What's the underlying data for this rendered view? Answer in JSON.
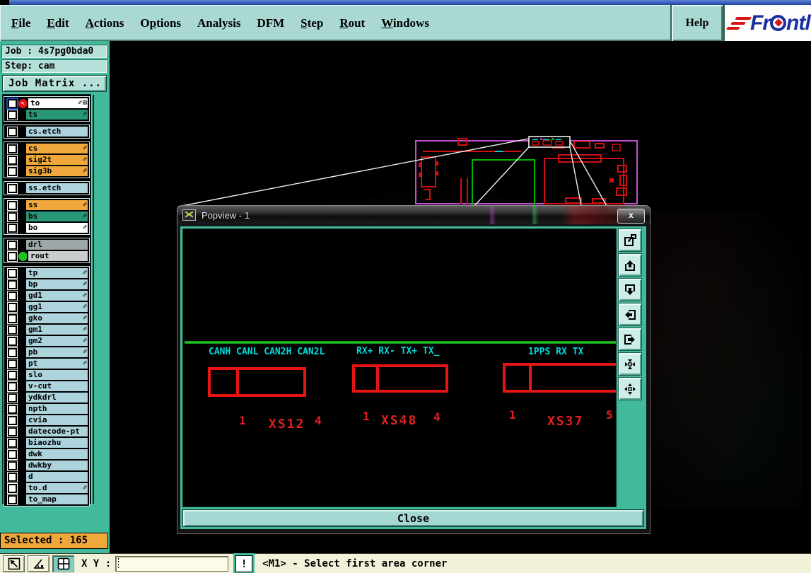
{
  "menu": {
    "items": [
      {
        "label": "File",
        "mnemonic": "F"
      },
      {
        "label": "Edit",
        "mnemonic": "E"
      },
      {
        "label": "Actions",
        "mnemonic": "A"
      },
      {
        "label": "Options",
        "mnemonic": "p"
      },
      {
        "label": "Analysis",
        "mnemonic": ""
      },
      {
        "label": "DFM",
        "mnemonic": ""
      },
      {
        "label": "Step",
        "mnemonic": "S"
      },
      {
        "label": "Rout",
        "mnemonic": "R"
      },
      {
        "label": "Windows",
        "mnemonic": "W"
      }
    ],
    "help_label": "Help",
    "logo": {
      "pre": "Fr",
      "post": "ntl"
    }
  },
  "sidebar": {
    "job_label": "Job : 4s7pg0bda0",
    "step_label": "Step: cam",
    "job_matrix_label": "Job Matrix ...",
    "selected_label": "Selected : 165",
    "layer_groups": [
      [
        {
          "name": "to",
          "color": "white",
          "pencil": true,
          "grid": true,
          "marker": "red",
          "focus": true
        },
        {
          "name": "ts",
          "color": "green",
          "pencil": true
        }
      ],
      [
        {
          "name": "cs.etch",
          "color": "blue"
        }
      ],
      [
        {
          "name": "cs",
          "color": "orange",
          "pencil": true
        },
        {
          "name": "sig2t",
          "color": "orange",
          "pencil": true
        },
        {
          "name": "sig3b",
          "color": "orange",
          "pencil": true
        }
      ],
      [
        {
          "name": "ss.etch",
          "color": "blue"
        }
      ],
      [
        {
          "name": "ss",
          "color": "orange",
          "pencil": true
        },
        {
          "name": "bs",
          "color": "green",
          "pencil": true
        },
        {
          "name": "bo",
          "color": "white",
          "pencil": true
        }
      ],
      [
        {
          "name": "drl",
          "color": "gray"
        },
        {
          "name": "rout",
          "color": "silver",
          "marker": "green"
        }
      ],
      [
        {
          "name": "tp",
          "color": "blue",
          "pencil": true
        },
        {
          "name": "bp",
          "color": "blue",
          "pencil": true
        },
        {
          "name": "gd1",
          "color": "blue",
          "pencil": true
        },
        {
          "name": "gg1",
          "color": "blue",
          "pencil": true
        },
        {
          "name": "gko",
          "color": "blue",
          "pencil": true
        },
        {
          "name": "gm1",
          "color": "blue",
          "pencil": true
        },
        {
          "name": "gm2",
          "color": "blue",
          "pencil": true
        },
        {
          "name": "pb",
          "color": "blue",
          "pencil": true
        },
        {
          "name": "pt",
          "color": "blue",
          "pencil": true
        },
        {
          "name": "slo",
          "color": "blue"
        },
        {
          "name": "v-cut",
          "color": "blue"
        },
        {
          "name": "ydkdrl",
          "color": "blue"
        },
        {
          "name": "npth",
          "color": "blue"
        },
        {
          "name": "cvia",
          "color": "blue"
        },
        {
          "name": "datecode-pt",
          "color": "blue"
        },
        {
          "name": "biaozhu",
          "color": "blue"
        },
        {
          "name": "dwk",
          "color": "blue"
        },
        {
          "name": "dwkby",
          "color": "blue"
        },
        {
          "name": "d",
          "color": "blue"
        },
        {
          "name": "to.d",
          "color": "blue",
          "pencil": true
        },
        {
          "name": "to_map",
          "color": "blue"
        }
      ]
    ]
  },
  "popup": {
    "title": "Popview - 1",
    "close_x": "x",
    "close_button_label": "Close",
    "tools": [
      "popview-window-icon",
      "pan-up-icon",
      "pan-down-icon",
      "pan-left-icon",
      "pan-right-icon",
      "zoom-in-arrows-icon",
      "zoom-out-arrows-icon"
    ],
    "connectors": [
      {
        "signals": "CANH CANL CAN2H CAN2L",
        "pin_first": "1",
        "ref": "XS12",
        "pin_last": "4"
      },
      {
        "signals": "RX+ RX- TX+ TX_",
        "pin_first": "1",
        "ref": "XS48",
        "pin_last": "4"
      },
      {
        "signals": "1PPS RX  TX",
        "pin_first": "1",
        "ref": "XS37",
        "pin_last": "5"
      }
    ]
  },
  "statusbar": {
    "xy_label": "X Y :",
    "input_value": "",
    "message": "<M1> - Select first area corner",
    "buttons": [
      "measure-diagonal-icon",
      "measure-angle-icon",
      "grid-window-icon",
      "exclamation-icon"
    ]
  },
  "colors": {
    "app_teal": "#41b99b",
    "panel_light": "#b5e0da",
    "menubar": "#a9d9d2",
    "statusbar_cream": "#f2f2da",
    "selected_orange": "#f0a83c",
    "layer_orange": "#f0a83c",
    "layer_green": "#2a9678",
    "layer_blue": "#add4dd",
    "pcb_red": "#e81414",
    "pcb_cyan": "#00d9d9",
    "pcb_green_line": "#2ad926",
    "board_magenta": "#c44fd0",
    "logo_blue": "#1a2f9e",
    "logo_red": "#d81414"
  }
}
